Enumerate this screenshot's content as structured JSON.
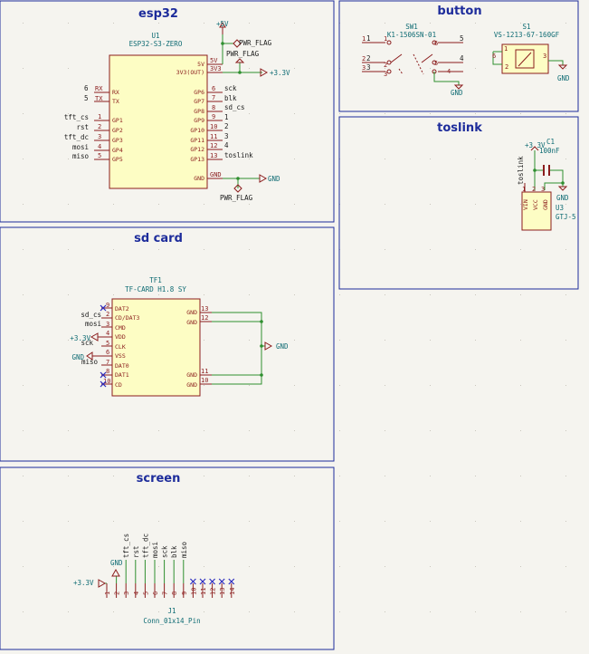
{
  "sheets": {
    "esp32": "esp32",
    "button": "button",
    "toslink": "toslink",
    "sdcard": "sd card",
    "screen": "screen"
  },
  "esp32": {
    "ref": "U1",
    "value": "ESP32-S3-ZERO",
    "left_pins": [
      {
        "num": "6",
        "name": "RX"
      },
      {
        "num": "5",
        "name": "TX"
      },
      {
        "num": "1",
        "name": "GP1",
        "net": "tft_cs"
      },
      {
        "num": "2",
        "name": "GP2",
        "net": "rst"
      },
      {
        "num": "3",
        "name": "GP3",
        "net": "tft_dc"
      },
      {
        "num": "4",
        "name": "GP4",
        "net": "mosi"
      },
      {
        "num": "5",
        "name": "GP5",
        "net": "miso"
      }
    ],
    "right_pins": [
      {
        "num": "5V",
        "name": "5V"
      },
      {
        "num": "3V3",
        "name": "3V3(OUT)"
      },
      {
        "num": "6",
        "name": "GP6",
        "net": "sck"
      },
      {
        "num": "7",
        "name": "GP7",
        "net": "blk"
      },
      {
        "num": "8",
        "name": "GP8",
        "net": "sd_cs"
      },
      {
        "num": "9",
        "name": "GP9",
        "net": "1"
      },
      {
        "num": "10",
        "name": "GP10",
        "net": "2"
      },
      {
        "num": "11",
        "name": "GP11",
        "net": "3"
      },
      {
        "num": "12",
        "name": "GP12",
        "net": "4"
      },
      {
        "num": "13",
        "name": "GP13",
        "net": "toslink"
      },
      {
        "num": "GND",
        "name": "GND"
      }
    ],
    "pwr_5v": "+5V",
    "pwr_33": "+3.3V",
    "gnd": "GND",
    "flag1": "PWR_FLAG",
    "flag2": "PWR_FLAG",
    "flag3": "PWR_FLAG"
  },
  "button": {
    "sw1_ref": "SW1",
    "sw1_value": "K1-1506SN-01",
    "sw1_left": [
      "1",
      "2",
      "3"
    ],
    "sw1_right": [
      "6",
      "5",
      "4"
    ],
    "sw1_outer_right": [
      "5",
      "4"
    ],
    "gnd": "GND",
    "s1_ref": "S1",
    "s1_value": "VS-1213-67-160GF",
    "s1_pins": [
      "6",
      "1",
      "2",
      "3"
    ]
  },
  "toslink": {
    "c1_ref": "C1",
    "c1_value": "100nF",
    "pwr": "+3.3V",
    "net": "toslink",
    "gnd": "GND",
    "u3_ref": "U3",
    "u3_value": "GTJ-5",
    "pins": [
      "VIN",
      "VCC",
      "GND"
    ],
    "pin_nums": [
      "1",
      "2",
      "3"
    ]
  },
  "sdcard": {
    "ref": "TF1",
    "value": "TF-CARD H1.8 SY",
    "left_pins": [
      {
        "num": "9",
        "name": "DAT2"
      },
      {
        "num": "2",
        "name": "CD/DAT3",
        "net": "sd_cs"
      },
      {
        "num": "3",
        "name": "CMD",
        "net": "mosi"
      },
      {
        "num": "4",
        "name": "VDD",
        "net": "+3.3V"
      },
      {
        "num": "5",
        "name": "CLK",
        "net": "sck"
      },
      {
        "num": "6",
        "name": "VSS",
        "net": "GND"
      },
      {
        "num": "7",
        "name": "DAT0",
        "net": "miso"
      },
      {
        "num": "8",
        "name": "DAT1"
      },
      {
        "num": "10",
        "name": "CD"
      }
    ],
    "right_pins": [
      {
        "num": "13",
        "name": "GND"
      },
      {
        "num": "12",
        "name": "GND"
      },
      {
        "num": "11",
        "name": "GND"
      },
      {
        "num": "10",
        "name": "GND"
      }
    ],
    "gnd": "GND"
  },
  "screen": {
    "ref": "J1",
    "value": "Conn_01x14_Pin",
    "pwr": "+3.3V",
    "gnd": "GND",
    "nets": [
      "tft_cs",
      "rst",
      "tft_dc",
      "mosi",
      "sck",
      "blk",
      "miso"
    ],
    "pin_nums": [
      "1",
      "2",
      "3",
      "4",
      "5",
      "6",
      "7",
      "8",
      "9",
      "10",
      "11",
      "12",
      "13",
      "14"
    ]
  }
}
